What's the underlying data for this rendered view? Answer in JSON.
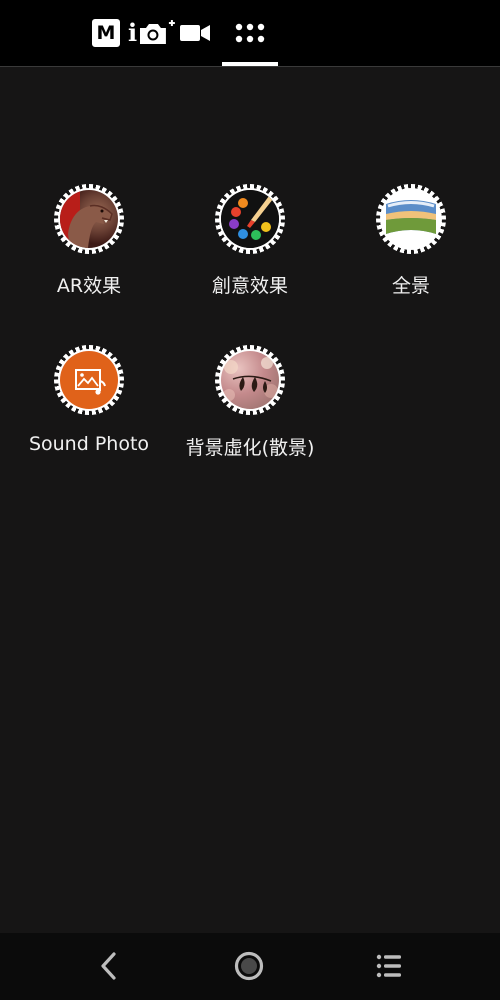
{
  "top_modes": [
    {
      "name": "manual-mode",
      "label": "M"
    },
    {
      "name": "smart-photo-plus",
      "label": "i"
    },
    {
      "name": "video",
      "label": ""
    },
    {
      "name": "more-modes",
      "label": ""
    }
  ],
  "effects": [
    {
      "label": "AR效果"
    },
    {
      "label": "創意效果"
    },
    {
      "label": "全景"
    },
    {
      "label": "Sound Photo"
    },
    {
      "label": "背景虛化(散景)"
    }
  ],
  "colors": {
    "background": "#161515",
    "topbar": "#000000",
    "accent_orange": "#e0621a"
  }
}
